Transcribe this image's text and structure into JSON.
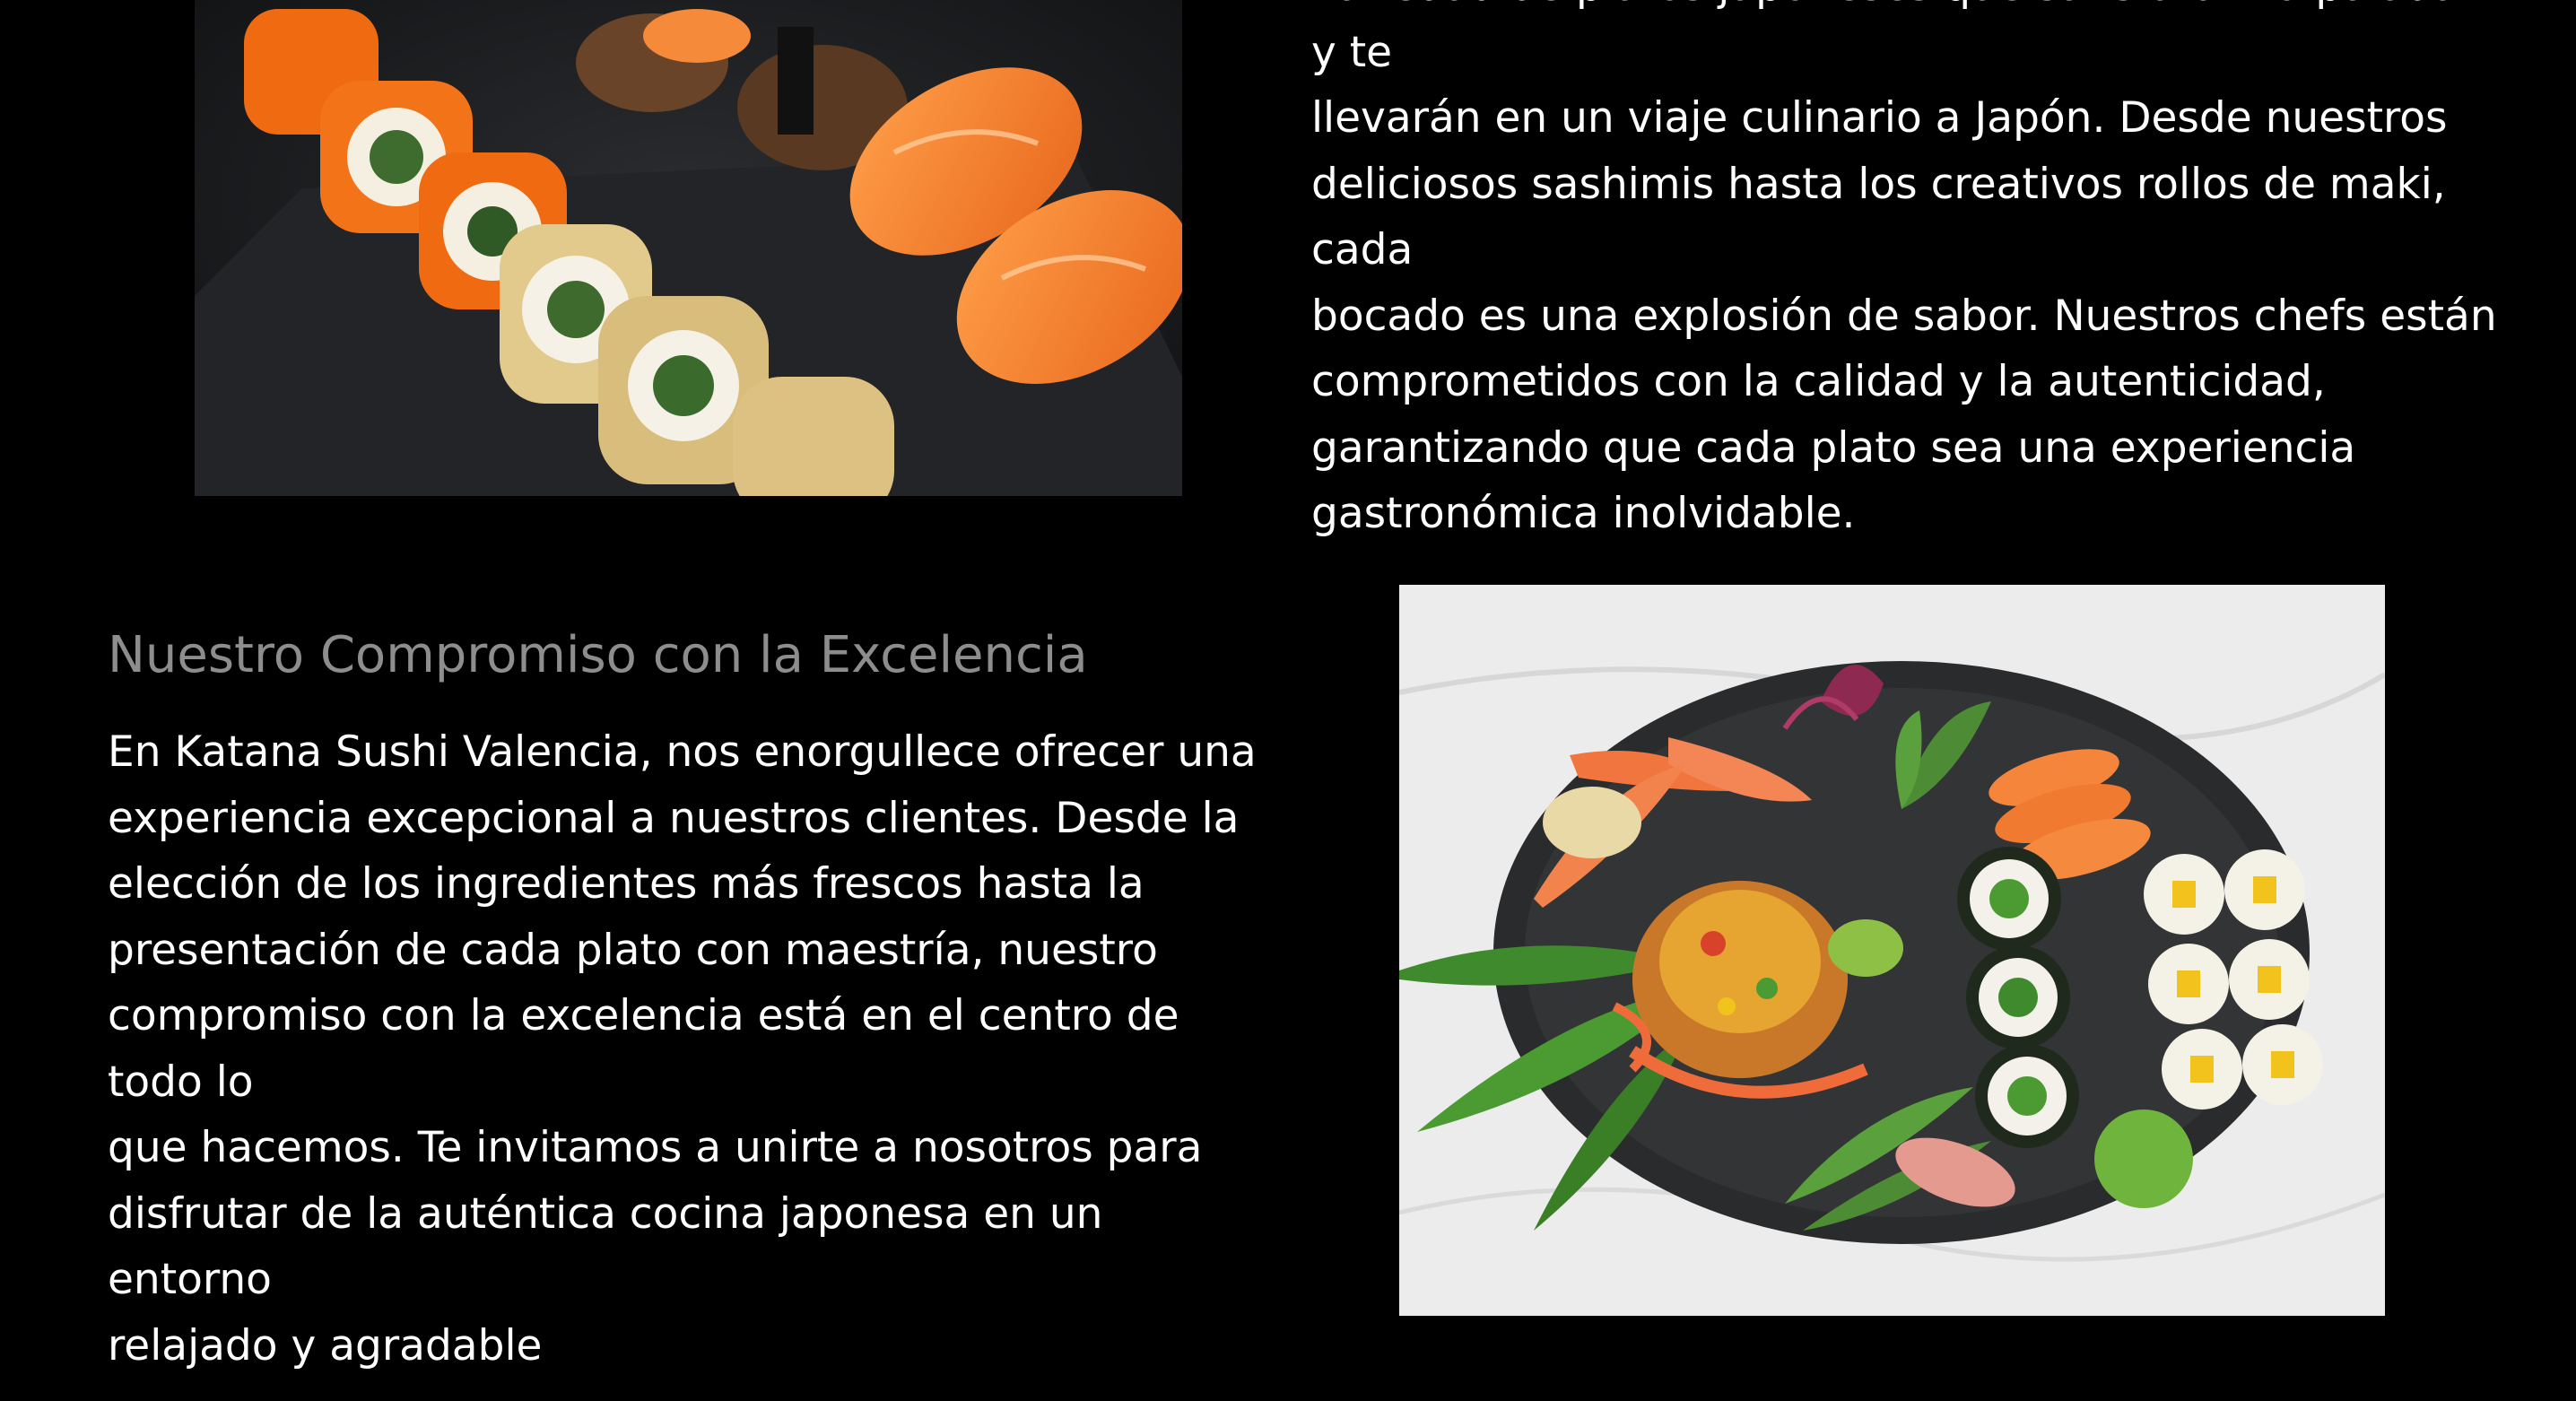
{
  "intro": {
    "paragraph": "variedad de platos japoneses que satisfarán tu paladar y te\nllevarán en un viaje culinario a Japón. Desde nuestros\ndeliciosos sashimis hasta los creativos rollos de maki, cada\nbocado es una explosión de sabor. Nuestros chefs están\ncomprometidos con la calidad y la autenticidad,\ngarantizando que cada plato sea una experiencia\ngastronómica inolvidable."
  },
  "commitment": {
    "heading": "Nuestro Compromiso con la Excelencia",
    "paragraph": "En Katana Sushi Valencia, nos enorgullece ofrecer una\nexperiencia excepcional a nuestros clientes. Desde la\nelección de los ingredientes más frescos hasta la\npresentación de cada plato con maestría, nuestro\ncompromiso con la excelencia está en el centro de todo lo\nque hacemos. Te invitamos a unirte a nosotros para\ndisfrutar de la auténtica cocina japonesa en un entorno\nrelajado y agradable"
  },
  "colors": {
    "background": "#000000",
    "text": "#ffffff",
    "heading": "#8d8d8d",
    "salmon": "#f3832f",
    "tobiko": "#f06a12",
    "slate": "#1b1c1e",
    "marble": "#ebebeb"
  }
}
